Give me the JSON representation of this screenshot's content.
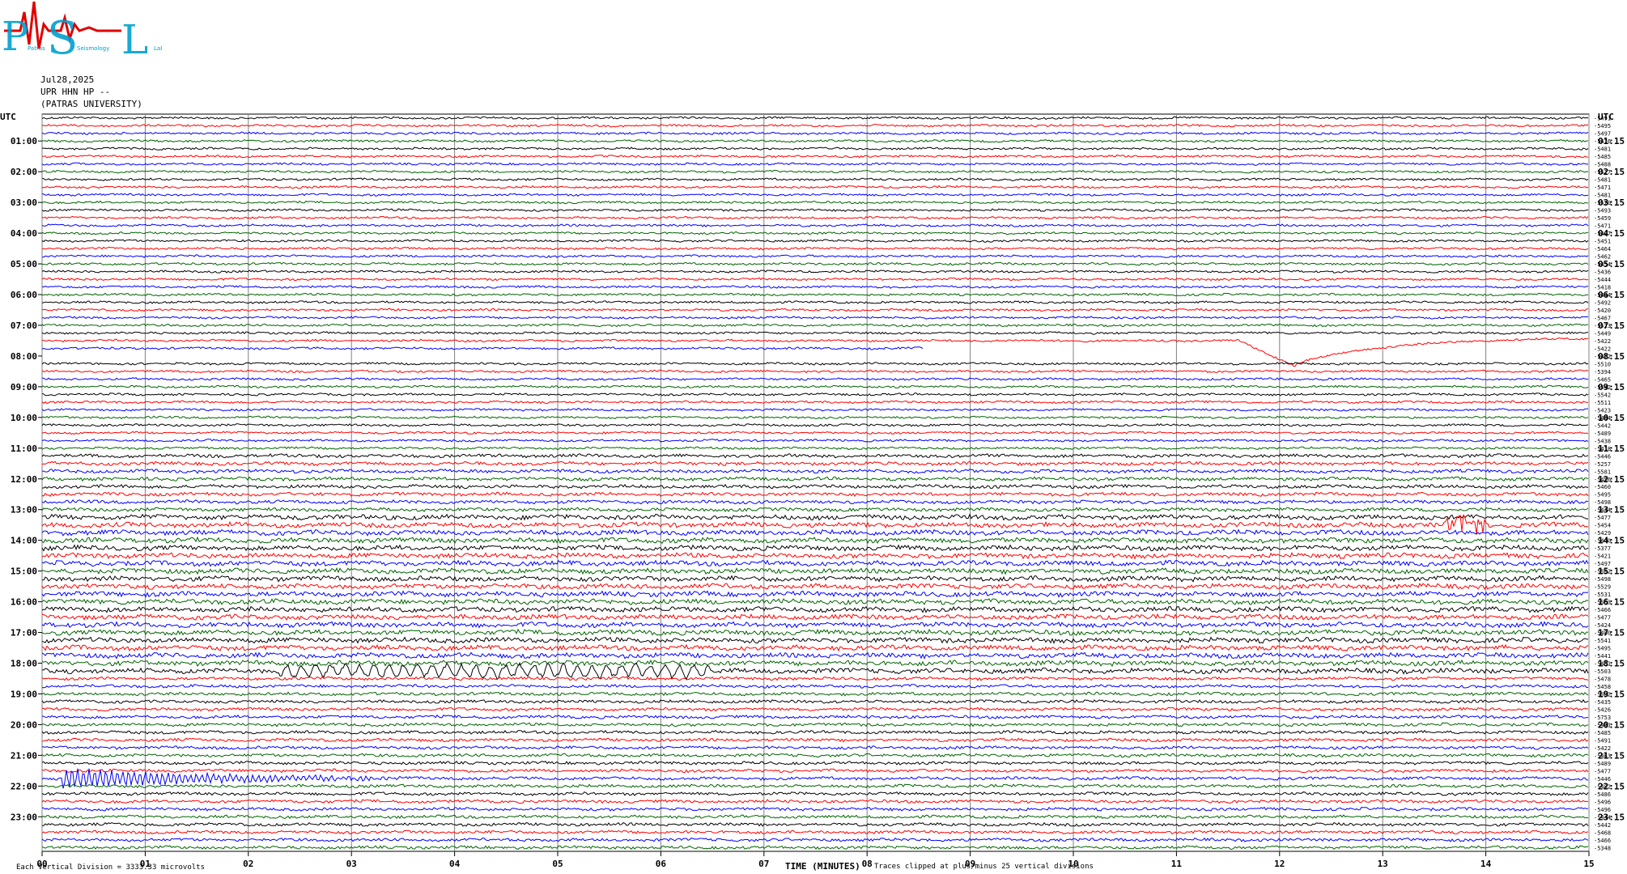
{
  "header": {
    "logo_text": "PSL",
    "logo_subtitle_parts": [
      "Patras",
      "Seismology",
      "Lab"
    ],
    "date": "Jul28,2025",
    "station": "UPR HHN HP --",
    "institution": "(PATRAS UNIVERSITY)"
  },
  "footer": {
    "scale_note": "Each Vertical Division = 3333.33 microvolts",
    "xlabel": "TIME (MINUTES)",
    "clip_note": "Traces clipped at plus/minus 25 vertical divisions"
  },
  "chart_data": {
    "type": "line",
    "title": "Jul28,2025",
    "xlabel": "TIME (MINUTES)",
    "ylabel": "UTC",
    "x_ticks": [
      "00",
      "01",
      "02",
      "03",
      "04",
      "05",
      "06",
      "07",
      "08",
      "09",
      "10",
      "11",
      "12",
      "13",
      "14",
      "15"
    ],
    "xlim": [
      0,
      15
    ],
    "left_axis_label": "UTC",
    "right_axis_label": "UTC",
    "left_hour_labels": [
      "01:00",
      "02:00",
      "03:00",
      "04:00",
      "05:00",
      "06:00",
      "07:00",
      "08:00",
      "09:00",
      "10:00",
      "11:00",
      "12:00",
      "13:00",
      "14:00",
      "15:00",
      "16:00",
      "17:00",
      "18:00",
      "19:00",
      "20:00",
      "21:00",
      "22:00",
      "23:00"
    ],
    "right_hour_labels": [
      "01:15",
      "02:15",
      "03:15",
      "04:15",
      "05:15",
      "06:15",
      "07:15",
      "08:15",
      "09:15",
      "10:15",
      "11:15",
      "12:15",
      "13:15",
      "14:15",
      "15:15",
      "16:15",
      "17:15",
      "18:15",
      "19:15",
      "20:15",
      "21:15",
      "22:15",
      "23:15"
    ],
    "trace_count": 96,
    "trace_colors": [
      "#000000",
      "#ff0000",
      "#0000ff",
      "#006400"
    ],
    "grid": "vertical lines at each minute",
    "trace_offsets": [
      -5491,
      -5495,
      -5497,
      -5476,
      -5481,
      -5485,
      -5488,
      -5517,
      -5481,
      -5471,
      -5481,
      -5520,
      -5493,
      -5459,
      -5471,
      -5497,
      -5451,
      -5464,
      -5462,
      -5454,
      -5436,
      -5444,
      -5418,
      -5444,
      -5492,
      -5420,
      -5467,
      -5523,
      -5449,
      -5422,
      -5422,
      -5422,
      -5510,
      -5394,
      -5465,
      -5542,
      -5542,
      -5511,
      -5423,
      -5494,
      -5442,
      -5489,
      -5438,
      -5418,
      -5446,
      -5257,
      -5581,
      -5456,
      -5460,
      -5495,
      -5498,
      -5444,
      -5477,
      -5454,
      -5429,
      -5440,
      -5377,
      -5421,
      -5497,
      -5502,
      -5498,
      -5529,
      -5531,
      -5563,
      -5466,
      -5477,
      -5424,
      -5480,
      -5541,
      -5495,
      -5441,
      -5451,
      -5503,
      -5478,
      -5458,
      -5502,
      -5435,
      -5426,
      -5753,
      -5491,
      -5485,
      -5491,
      -5422,
      -5463,
      -5489,
      -5477,
      -5446,
      -5482,
      -5486,
      -5496,
      -5496,
      -5444,
      -5442,
      -5468,
      -5466,
      -5348,
      -5480,
      -5452
    ],
    "events": [
      {
        "label": "sharp excursion",
        "trace_index": 29,
        "minute_start": 11.6,
        "minute_end": 15,
        "color": "#0000ff"
      },
      {
        "label": "strong burst",
        "trace_index": 86,
        "minute_start": 0.2,
        "minute_end": 3.5,
        "color": "#0000ff"
      },
      {
        "label": "spike",
        "trace_index": 53,
        "minute_start": 13.6,
        "minute_end": 14.0,
        "color": "#0000ff"
      },
      {
        "label": "wave group",
        "trace_index": 72,
        "minute_start": 2.3,
        "minute_end": 6.5,
        "color": "#000000"
      }
    ]
  }
}
